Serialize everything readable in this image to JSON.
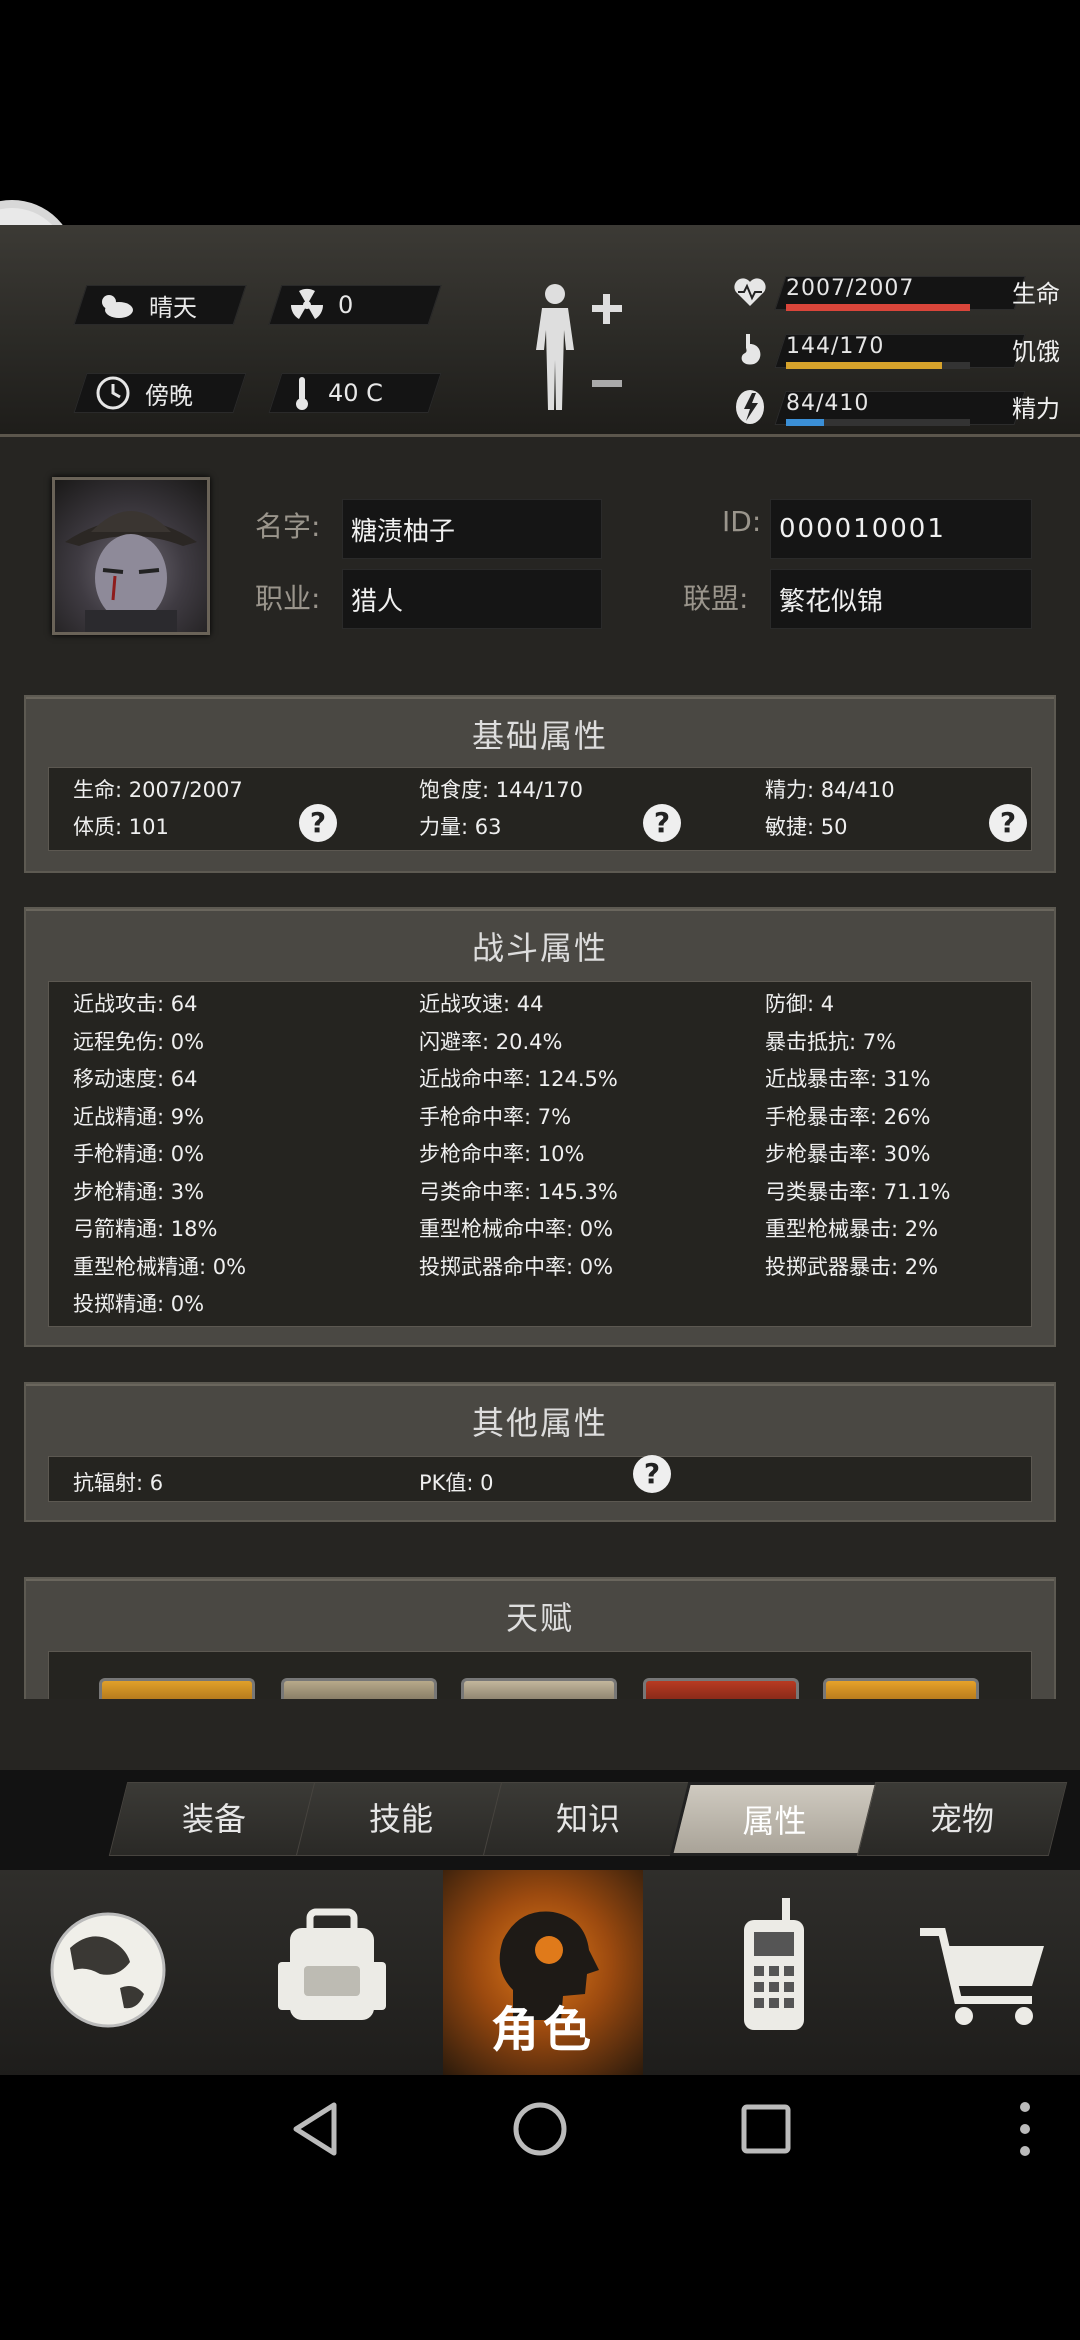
{
  "status": {
    "weather": "晴天",
    "radiation": "0",
    "time_of_day": "傍晚",
    "temperature": "40 C"
  },
  "vitals": {
    "health": {
      "value": "2007/2007",
      "label": "生命",
      "fraction": 1.0,
      "color": "#d9453a"
    },
    "hunger": {
      "value": "144/170",
      "label": "饥饿",
      "fraction": 0.847,
      "color": "#d6a22b"
    },
    "energy": {
      "value": "84/410",
      "label": "精力",
      "fraction": 0.205,
      "color": "#3b8fd6"
    }
  },
  "profile": {
    "name_label": "名字:",
    "name": "糖渍柚子",
    "id_label": "ID:",
    "id": "000010001",
    "job_label": "职业:",
    "job": "猎人",
    "alliance_label": "联盟:",
    "alliance": "繁花似锦"
  },
  "basic": {
    "title": "基础属性",
    "row1": [
      "生命: 2007/2007",
      "饱食度: 144/170",
      "精力: 84/410"
    ],
    "row2": [
      "体质: 101",
      "力量: 63",
      "敏捷: 50"
    ],
    "help": "?"
  },
  "combat": {
    "title": "战斗属性",
    "col1": [
      "近战攻击: 64",
      "远程免伤: 0%",
      "移动速度: 64",
      "近战精通: 9%",
      "手枪精通: 0%",
      "步枪精通: 3%",
      "弓箭精通: 18%",
      "重型枪械精通: 0%",
      "投掷精通: 0%"
    ],
    "col2": [
      "近战攻速: 44",
      "闪避率: 20.4%",
      "近战命中率: 124.5%",
      "手枪命中率: 7%",
      "步枪命中率: 10%",
      "弓类命中率: 145.3%",
      "重型枪械命中率: 0%",
      "投掷武器命中率: 0%"
    ],
    "col3": [
      "防御: 4",
      "暴击抵抗: 7%",
      "近战暴击率: 31%",
      "手枪暴击率: 26%",
      "步枪暴击率: 30%",
      "弓类暴击率: 71.1%",
      "重型枪械暴击: 2%",
      "投掷武器暴击: 2%"
    ]
  },
  "other": {
    "title": "其他属性",
    "items": [
      "抗辐射: 6",
      "PK值: 0"
    ],
    "help": "?"
  },
  "talent": {
    "title": "天赋"
  },
  "tabs": [
    "装备",
    "技能",
    "知识",
    "属性",
    "宠物"
  ],
  "active_tab": "属性",
  "bottom_nav": {
    "active_label": "角色"
  }
}
